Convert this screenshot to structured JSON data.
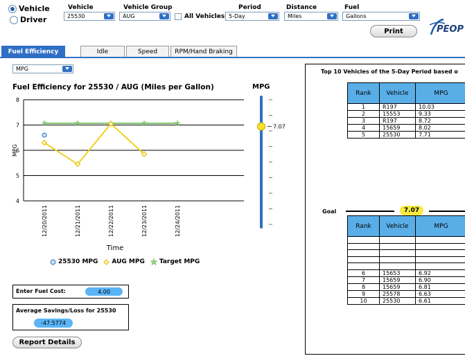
{
  "filters": {
    "vehicle_radio": "Vehicle",
    "driver_radio": "Driver",
    "vehicle_label": "Vehicle",
    "vehicle_value": "25530",
    "group_label": "Vehicle Group",
    "group_value": "AUG",
    "all_vehicles_label": "All Vehicles",
    "period_label": "Period",
    "period_value": "5-Day",
    "distance_label": "Distance",
    "distance_value": "Miles",
    "fuel_label": "Fuel",
    "fuel_value": "Gallons",
    "print_label": "Print",
    "logo_text": "PEOP"
  },
  "tabs": [
    "Fuel Efficiency",
    "Idle",
    "Speed",
    "RPM/Hand Braking"
  ],
  "metric_select": "MPG",
  "chart_title": "Fuel Efficiency for 25530 / AUG (Miles per Gallon)",
  "slider": {
    "label": "MPG",
    "value_text": "7.07",
    "value": 7.07
  },
  "chart_data": {
    "type": "line",
    "categories": [
      "12/20/2011",
      "12/21/2011",
      "12/22/2011",
      "12/23/2011",
      "12/24/2011"
    ],
    "series": [
      {
        "name": "25530 MPG",
        "values": [
          6.6,
          null,
          null,
          null,
          null
        ],
        "color": "#4a86c8"
      },
      {
        "name": "AUG MPG",
        "values": [
          6.3,
          5.45,
          7.05,
          5.85,
          null
        ],
        "color": "#f0d020"
      },
      {
        "name": "Target MPG",
        "values": [
          7.07,
          7.07,
          7.07,
          7.07,
          7.07
        ],
        "color": "#7ac36a"
      }
    ],
    "xlabel": "Time",
    "ylabel": "MPG",
    "ylim": [
      4,
      8
    ],
    "yticks": [
      "8",
      "7",
      "6",
      "5",
      "4"
    ]
  },
  "legend": [
    {
      "icon": "circle-marker",
      "label": "25530 MPG"
    },
    {
      "icon": "diamond-marker",
      "label": "AUG MPG"
    },
    {
      "icon": "star-marker",
      "label": "Target MPG"
    }
  ],
  "fuel_cost": {
    "label": "Enter Fuel Cost:",
    "value": "4.00"
  },
  "savings": {
    "label": "Average Savings/Loss for 25530",
    "value": "-47.5774"
  },
  "report_button": "Report Details",
  "top10": {
    "title": "Top 10 Vehicles of the 5-Day Period based o",
    "headers": [
      "Rank",
      "Vehicle",
      "MPG"
    ],
    "rows": [
      [
        "1",
        "R197",
        "10.03"
      ],
      [
        "2",
        "15553",
        "9.33"
      ],
      [
        "3",
        "R197",
        "8.72"
      ],
      [
        "4",
        "15659",
        "8.02"
      ],
      [
        "5",
        "25530",
        "7.71"
      ]
    ]
  },
  "goal": {
    "label": "Goal",
    "value": "7.07"
  },
  "bottom10": {
    "headers": [
      "Rank",
      "Vehicle",
      "MPG"
    ],
    "rows": [
      [
        "",
        "",
        ""
      ],
      [
        "",
        "",
        ""
      ],
      [
        "",
        "",
        ""
      ],
      [
        "",
        "",
        ""
      ],
      [
        "",
        "",
        ""
      ],
      [
        "6",
        "15653",
        "6.92"
      ],
      [
        "7",
        "15659",
        "6.90"
      ],
      [
        "8",
        "15659",
        "6.81"
      ],
      [
        "9",
        "25578",
        "6.63"
      ],
      [
        "10",
        "25530",
        "6.61"
      ]
    ]
  }
}
